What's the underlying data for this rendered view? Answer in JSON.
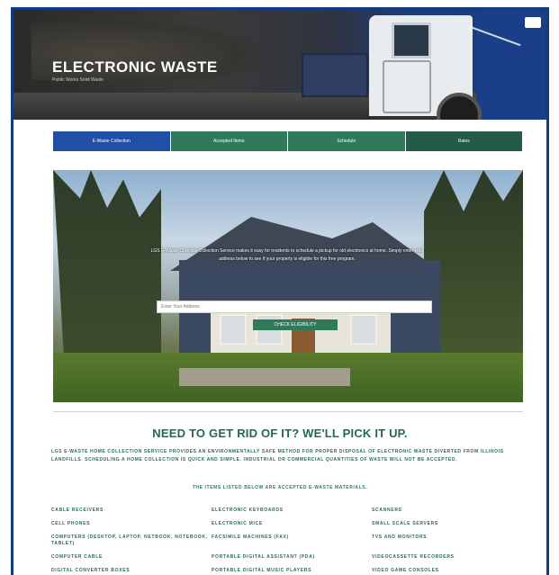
{
  "hero": {
    "title": "ELECTRONIC WASTE",
    "subtitle": "Public Works Solid Waste"
  },
  "tabs": [
    {
      "label": "E-Waste Collection"
    },
    {
      "label": "Accepted Items"
    },
    {
      "label": "Schedule"
    },
    {
      "label": "Rates"
    }
  ],
  "banner": {
    "text": "LGS E-Waste Curbside Collection Service makes it easy for residents to schedule a pickup for old electronics at home. Simply enter your address below to see if your property is eligible for this free program.",
    "search_placeholder": "Enter Your Address",
    "button_label": "CHECK ELIGIBILITY"
  },
  "section": {
    "headline": "NEED TO GET RID OF IT?  WE'LL PICK IT UP.",
    "intro": "LGS E-WASTE HOME COLLECTION SERVICE PROVIDES AN ENVIRONMENTALLY SAFE METHOD FOR PROPER DISPOSAL OF ELECTRONIC WASTE DIVERTED FROM ILLINOIS LANDFILLS. SCHEDULING A HOME COLLECTION IS QUICK AND SIMPLE. INDUSTRIAL OR COMMERCIAL QUANTITIES OF WASTE WILL NOT BE ACCEPTED.",
    "subhead": "THE ITEMS LISTED BELOW ARE ACCEPTED E-WASTE MATERIALS.",
    "items": [
      "CABLE RECEIVERS",
      "ELECTRONIC KEYBOARDS",
      "SCANNERS",
      "CELL PHONES",
      "ELECTRONIC MICE",
      "SMALL SCALE SERVERS",
      "COMPUTERS (DESKTOP, LAPTOP, NETBOOK, NOTEBOOK, TABLET)",
      "FACSIMILE MACHINES (FAX)",
      "TVS AND MONITORS",
      "COMPUTER CABLE",
      "PORTABLE DIGITAL ASSISTANT (PDA)",
      "VIDEOCASSETTE RECORDERS",
      "DIGITAL CONVERTER BOXES",
      "PORTABLE DIGITAL MUSIC PLAYERS",
      "VIDEO GAME CONSOLES"
    ]
  },
  "colors": {
    "frame": "#143a86",
    "tab_blue": "#1f4fa6",
    "tab_green": "#2e7a5b",
    "headline_green": "#1f6b4d"
  }
}
